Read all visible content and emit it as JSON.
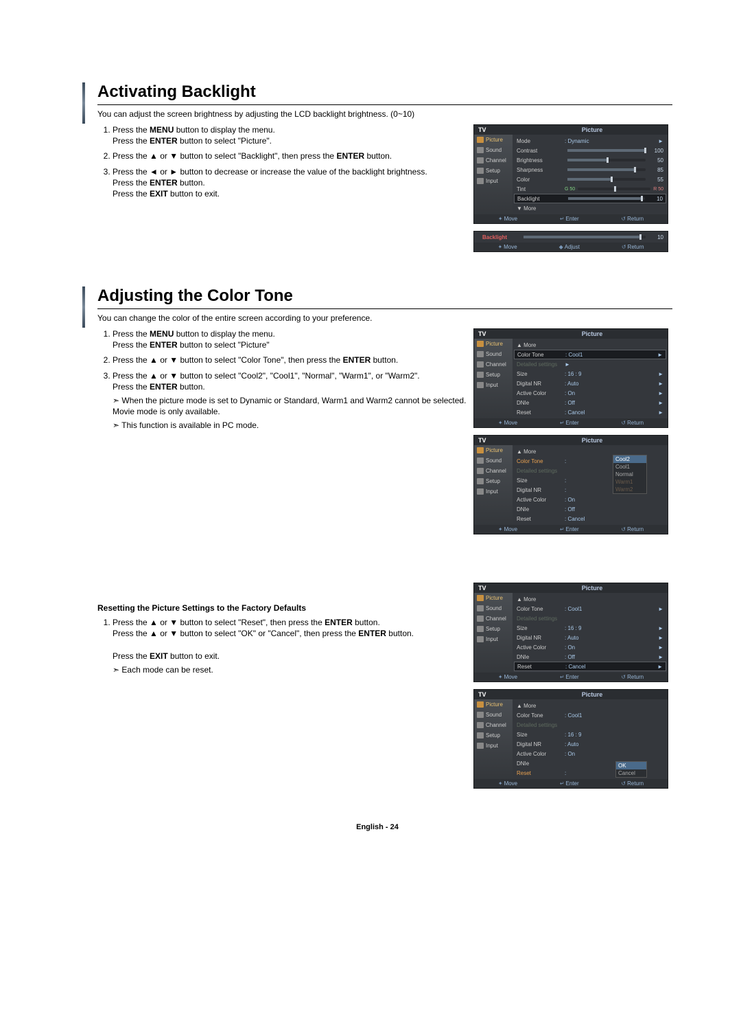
{
  "sections": {
    "backlight": {
      "title": "Activating Backlight",
      "intro": "You can adjust the screen brightness by adjusting the LCD backlight brightness. (0~10)",
      "steps": [
        {
          "pre": "Press the ",
          "b1": "MENU",
          "mid1": " button to display the menu.\nPress the ",
          "b2": "ENTER",
          "mid2": " button to select \"Picture\"."
        },
        {
          "pre": "Press the ▲ or ▼ button to select \"Backlight\", then press the ",
          "b1": "ENTER",
          "mid1": " button."
        },
        {
          "pre": "Press the ◄ or ► button to decrease or increase the value of the backlight brightness.\nPress the ",
          "b1": "ENTER",
          "mid1": " button.\nPress the ",
          "b2": "EXIT",
          "mid2": " button to exit."
        }
      ]
    },
    "colortone": {
      "title": "Adjusting the Color Tone",
      "intro": "You can change the color of the entire screen according to your preference.",
      "steps": [
        {
          "pre": "Press the ",
          "b1": "MENU",
          "mid1": " button to display the menu.\nPress the ",
          "b2": "ENTER",
          "mid2": " button to select \"Picture\""
        },
        {
          "pre": "Press the ▲ or ▼ button to select \"Color Tone\", then press the ",
          "b1": "ENTER",
          "mid1": " button."
        },
        {
          "pre": "Press the ▲ or ▼ button to select \"Cool2\", \"Cool1\", \"Normal\", \"Warm1\", or \"Warm2\".\nPress the ",
          "b1": "ENTER",
          "mid1": " button."
        }
      ],
      "notes": [
        "When the picture mode is set to Dynamic or Standard, Warm1 and Warm2 cannot be selected. Movie mode is only available.",
        "This function is available in PC mode."
      ]
    },
    "reset": {
      "heading": "Resetting the Picture Settings to the Factory Defaults",
      "steps": [
        {
          "pre": "Press the ▲ or ▼ button to select \"Reset\", then press the ",
          "b1": "ENTER",
          "mid1": " button.\nPress the ▲ or ▼ button to select \"OK\" or \"Cancel\", then press the ",
          "b2": "ENTER",
          "mid2": " button.\n\nPress the ",
          "b3": "EXIT",
          "mid3": " button to exit."
        }
      ],
      "note": "Each mode can be reset."
    }
  },
  "osd": {
    "tv": "TV",
    "panel": "Picture",
    "side": [
      "Picture",
      "Sound",
      "Channel",
      "Setup",
      "Input"
    ],
    "picture_sliders": {
      "mode": {
        "label": "Mode",
        "value": ": Dynamic"
      },
      "contrast": {
        "label": "Contrast",
        "num": "100",
        "pct": 100
      },
      "brightness": {
        "label": "Brightness",
        "num": "50",
        "pct": 50
      },
      "sharpness": {
        "label": "Sharpness",
        "num": "85",
        "pct": 85
      },
      "color": {
        "label": "Color",
        "num": "55",
        "pct": 55
      },
      "tint": {
        "label": "Tint",
        "g": "G 50",
        "r": "R 50",
        "pct": 50
      },
      "backlight": {
        "label": "Backlight",
        "num": "10",
        "pct": 95
      },
      "more": "▼ More"
    },
    "strip": {
      "label": "Backlight",
      "num": "10",
      "pct": 95
    },
    "footer": {
      "move": "Move",
      "enter": "Enter",
      "ret": "Return",
      "adjust": "Adjust"
    },
    "more_menu": {
      "more": "▲ More",
      "colortone": {
        "label": "Color Tone",
        "value": ": Cool1"
      },
      "detailed": {
        "label": "Detailed settings"
      },
      "size": {
        "label": "Size",
        "value": ": 16 : 9"
      },
      "digitalnr": {
        "label": "Digital NR",
        "value": ": Auto"
      },
      "activecolor": {
        "label": "Active Color",
        "value": ": On"
      },
      "dnie": {
        "label": "DNIe",
        "value": ": Off"
      },
      "reset": {
        "label": "Reset",
        "value": ": Cancel"
      }
    },
    "options": [
      "Cool2",
      "Cool1",
      "Normal",
      "Warm1",
      "Warm2"
    ],
    "reset_opts": {
      "ok": "OK",
      "cancel": "Cancel"
    }
  },
  "footer": "English - 24"
}
